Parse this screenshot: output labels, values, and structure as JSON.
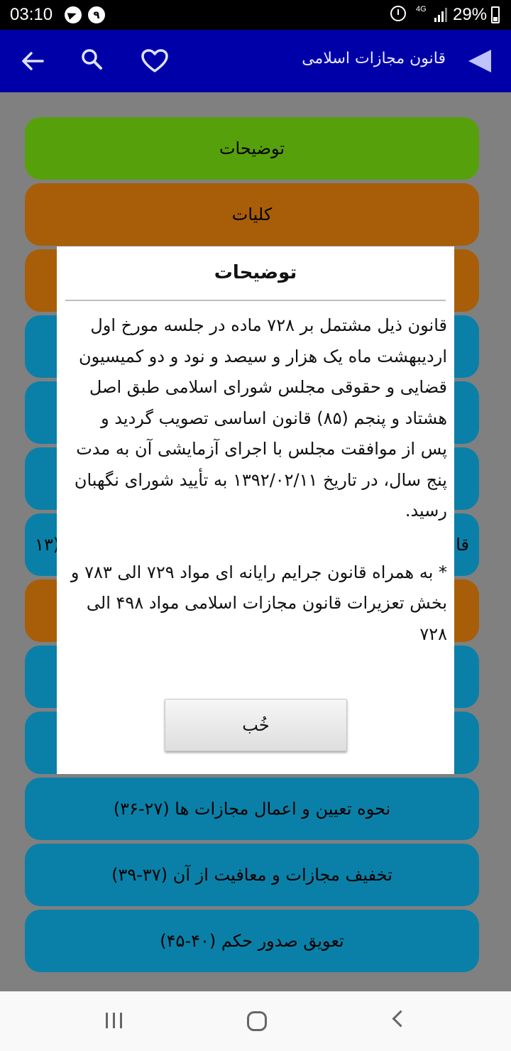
{
  "status_bar": {
    "time": "03:10",
    "notification_badge": "۹",
    "network": "4G",
    "battery": "29%"
  },
  "app_bar": {
    "title": "قانون مجازات اسلامی",
    "icons": [
      "back-arrow",
      "search",
      "heart",
      "play-triangle"
    ]
  },
  "list": {
    "items": [
      {
        "label": "توضیحات",
        "color": "#56a00c"
      },
      {
        "label": "کلیات",
        "color": "#a85e08"
      },
      {
        "label": "",
        "color": "#a85e08"
      },
      {
        "label": "",
        "color": "#0a80a8"
      },
      {
        "label": "",
        "color": "#0a80a8"
      },
      {
        "label": "",
        "color": "#0a80a8"
      },
      {
        "label": "قا",
        "trail": "(۱۳",
        "color": "#0a80a8"
      },
      {
        "label": "",
        "color": "#a85e08"
      },
      {
        "label": "",
        "color": "#0a80a8"
      },
      {
        "label": "",
        "color": "#0a80a8"
      },
      {
        "label": "نحوه تعیین و اعمال مجازات ها (۲۷-۳۶)",
        "color": "#0a80a8"
      },
      {
        "label": "تخفیف مجازات و معافیت از آن (۳۷-۳۹)",
        "color": "#0a80a8"
      },
      {
        "label": "تعویق صدور حکم (۴۰-۴۵)",
        "color": "#0a80a8"
      }
    ]
  },
  "dialog": {
    "title": "توضیحات",
    "body": "قانون ذیل مشتمل بر ۷۲۸ ماده در جلسه مورخ اول اردیبهشت ماه یک هزار و سیصد و نود و دو کمیسیون قضایی و حقوقی مجلس شورای اسلامی طبق اصل هشتاد و پنجم (۸۵) قانون اساسی تصویب گردید و پس از موافقت مجلس با اجرای آزمایشی آن به مدت پنج سال، در تاریخ ۱۳۹۲/۰۲/۱۱ به تأیید شورای نگهبان رسید.",
    "note": "* به همراه قانون جرایم رایانه ای مواد ۷۲۹ الی ۷۸۳ و بخش تعزیرات قانون مجازات اسلامی مواد ۴۹۸ الی ۷۲۸",
    "ok_label": "خُب"
  },
  "colors": {
    "app_bar": "#0000a8",
    "green": "#56a00c",
    "orange": "#a85e08",
    "blue": "#0a80a8",
    "scrim": "#808080"
  }
}
